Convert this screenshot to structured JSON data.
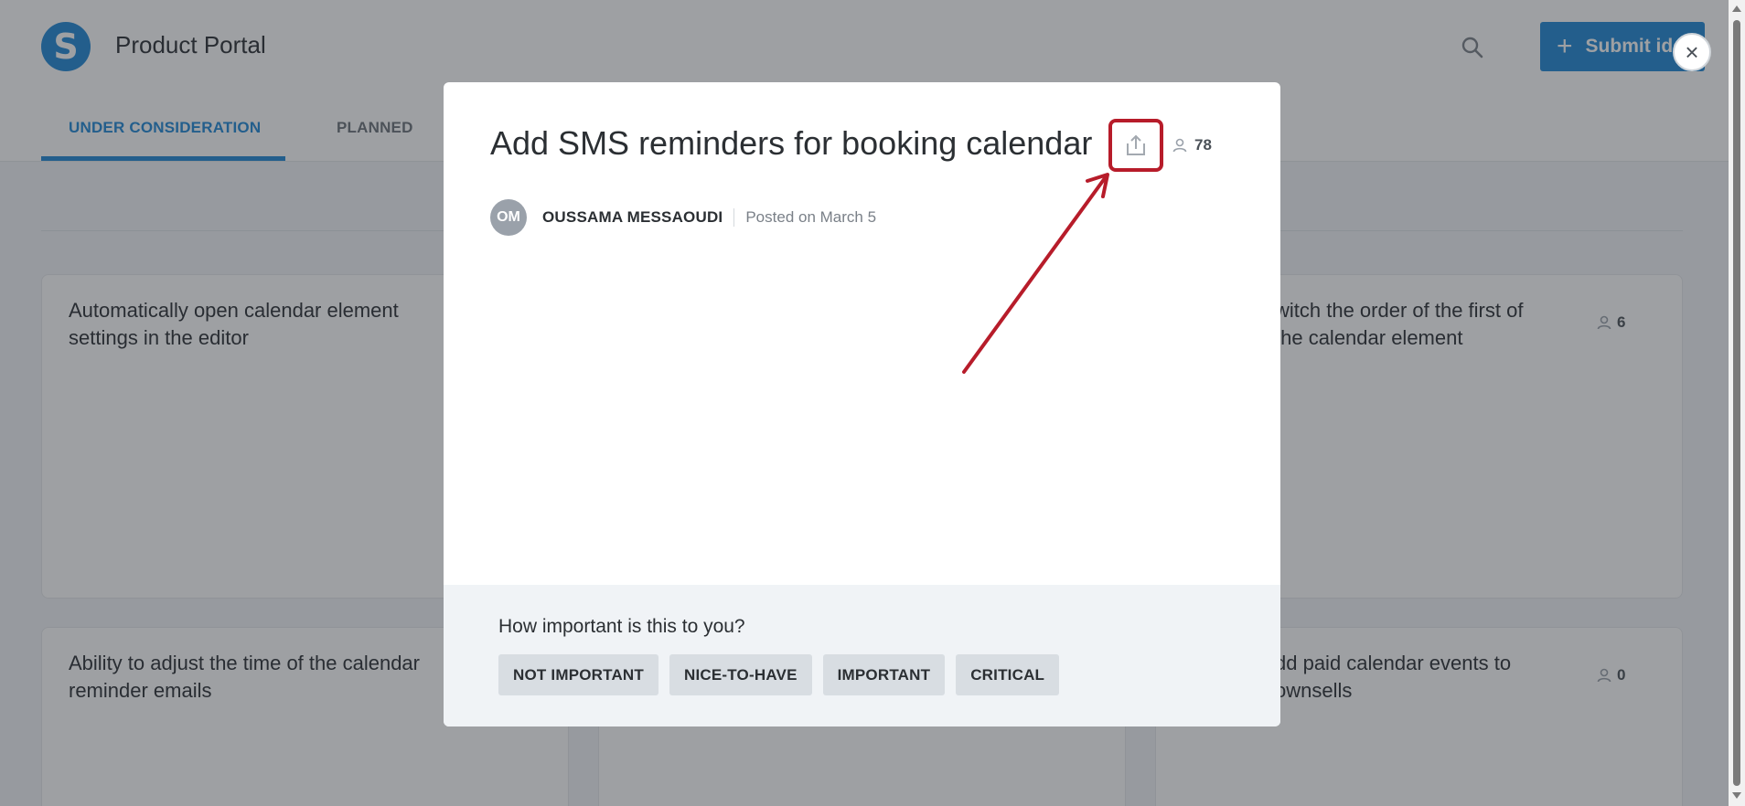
{
  "header": {
    "logo_letter": "S",
    "title": "Product Portal",
    "submit_label": "Submit idea"
  },
  "tabs": [
    {
      "label": "UNDER CONSIDERATION",
      "active": true
    },
    {
      "label": "PLANNED",
      "active": false
    }
  ],
  "cards": [
    {
      "title": "Automatically open calendar element settings in the editor",
      "votes": ""
    },
    {
      "title": "witch the order of the first of the calendar element",
      "votes": "6"
    },
    {
      "title": "Ability to adjust the time of the calendar reminder emails",
      "votes": ""
    },
    {
      "title": "dd paid calendar events to ownsells",
      "votes": "0"
    }
  ],
  "modal": {
    "title": "Add SMS reminders for booking calendar",
    "votes": "78",
    "author_initials": "OM",
    "author_name": "OUSSAMA MESSAOUDI",
    "posted": "Posted on March 5",
    "importance_question": "How important is this to you?",
    "options": [
      "NOT IMPORTANT",
      "NICE-TO-HAVE",
      "IMPORTANT",
      "CRITICAL"
    ]
  },
  "icons": {
    "search": "search-icon",
    "share": "share-icon",
    "voter": "user-icon",
    "close": "close-icon"
  },
  "colors": {
    "accent": "#1f88d6",
    "annotation": "#b71c2a"
  }
}
